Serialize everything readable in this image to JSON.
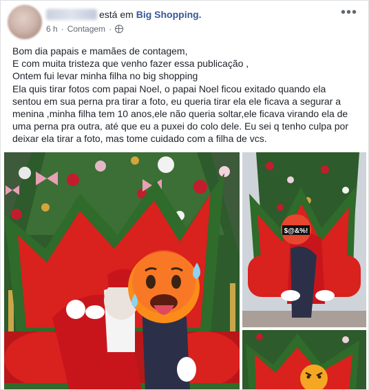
{
  "post": {
    "author_verb": "está em",
    "place": "Big Shopping.",
    "time": "6 h",
    "separator": "·",
    "location": "Contagem",
    "more_icon": "more-horizontal-icon",
    "privacy_icon": "globe-icon",
    "lines": [
      "Bom dia papais e mamães de contagem,",
      "E com muita tristeza que venho fazer essa publicação ,",
      "Ontem fui levar minha filha no big shopping",
      "Ela quis tirar fotos com papai Noel, o papai Noel ficou exitado quando ela",
      "sentou em sua perna pra tirar a foto, eu queria tirar ela ele ficava a segurar a",
      "menina ,minha filha tem 10 anos,ele não queria soltar,ele ficava virando ela de",
      "uma perna pra outra, até que eu a puxei do colo dele. Eu sei q tenho culpa por",
      "deixar ela tirar a foto, mas tome cuidado com a filha de vcs."
    ]
  },
  "photos": {
    "main": {
      "emoji": "hot-face-emoji"
    },
    "top_right": {
      "censored_text": "$@&%!",
      "emoji": "cursing-face-emoji"
    },
    "bottom_right": {
      "emoji": "angry-face-emoji"
    }
  },
  "colors": {
    "link": "#365899",
    "text": "#1d2129",
    "meta": "#616770",
    "throne_red": "#d9211d",
    "throne_green": "#2f6b2a",
    "tree_green": "#2d5b2b"
  }
}
